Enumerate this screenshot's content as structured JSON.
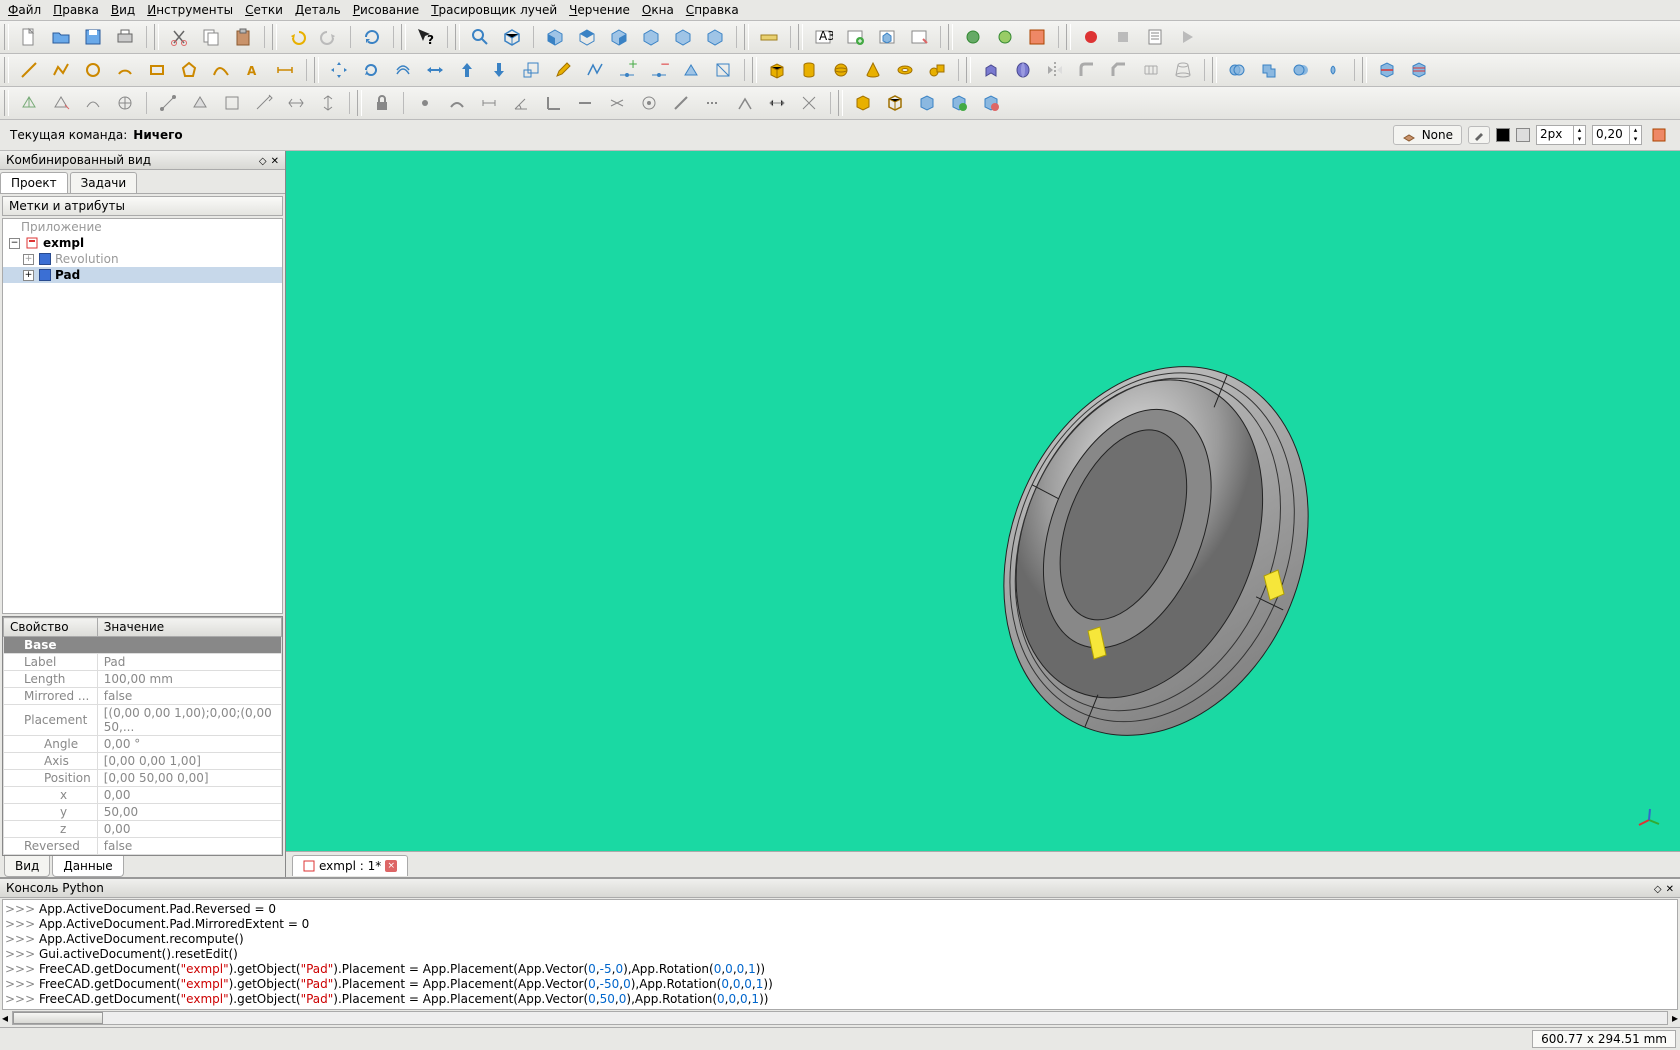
{
  "menu": [
    "Файл",
    "Правка",
    "Вид",
    "Инструменты",
    "Сетки",
    "Деталь",
    "Рисование",
    "Трасировщик лучей",
    "Черчение",
    "Окна",
    "Справка"
  ],
  "status": {
    "label": "Текущая команда:",
    "value": "Ничего"
  },
  "style": {
    "none": "None",
    "px": "2px",
    "val": "0,20"
  },
  "combo": {
    "title": "Комбинированный вид",
    "tabs": {
      "project": "Проект",
      "tasks": "Задачи"
    },
    "section": "Метки и атрибуты",
    "app": "Приложение",
    "doc": "exmpl",
    "items": [
      "Revolution",
      "Pad"
    ]
  },
  "props": {
    "headers": {
      "prop": "Свойство",
      "val": "Значение"
    },
    "group": "Base",
    "rows": {
      "label": {
        "k": "Label",
        "v": "Pad"
      },
      "length": {
        "k": "Length",
        "v": "100,00 mm"
      },
      "mirrored": {
        "k": "Mirrored ...",
        "v": "false"
      },
      "placement": {
        "k": "Placement",
        "v": "[(0,00 0,00 1,00);0,00;(0,00 50,..."
      },
      "angle": {
        "k": "Angle",
        "v": "0,00 °"
      },
      "axis": {
        "k": "Axis",
        "v": "[0,00 0,00 1,00]"
      },
      "position": {
        "k": "Position",
        "v": "[0,00 50,00 0,00]"
      },
      "x": {
        "k": "x",
        "v": "0,00"
      },
      "y": {
        "k": "y",
        "v": "50,00"
      },
      "z": {
        "k": "z",
        "v": "0,00"
      },
      "reversed": {
        "k": "Reversed",
        "v": "false"
      }
    },
    "bottabs": {
      "view": "Вид",
      "data": "Данные"
    }
  },
  "docTab": {
    "label": "exmpl : 1*"
  },
  "console": {
    "title": "Консоль Python",
    "lines": [
      "App.ActiveDocument.Pad.Reversed = 0",
      "App.ActiveDocument.Pad.MirroredExtent = 0",
      "App.ActiveDocument.recompute()",
      "Gui.activeDocument().resetEdit()",
      "FreeCAD.getDocument(\"exmpl\").getObject(\"Pad\").Placement = App.Placement(App.Vector(0,-5,0),App.Rotation(0,0,0,1))",
      "FreeCAD.getDocument(\"exmpl\").getObject(\"Pad\").Placement = App.Placement(App.Vector(0,-50,0),App.Rotation(0,0,0,1))",
      "FreeCAD.getDocument(\"exmpl\").getObject(\"Pad\").Placement = App.Placement(App.Vector(0,50,0),App.Rotation(0,0,0,1))"
    ],
    "prompt": ">>> "
  },
  "footer": {
    "dims": "600.77 x 294.51 mm"
  }
}
